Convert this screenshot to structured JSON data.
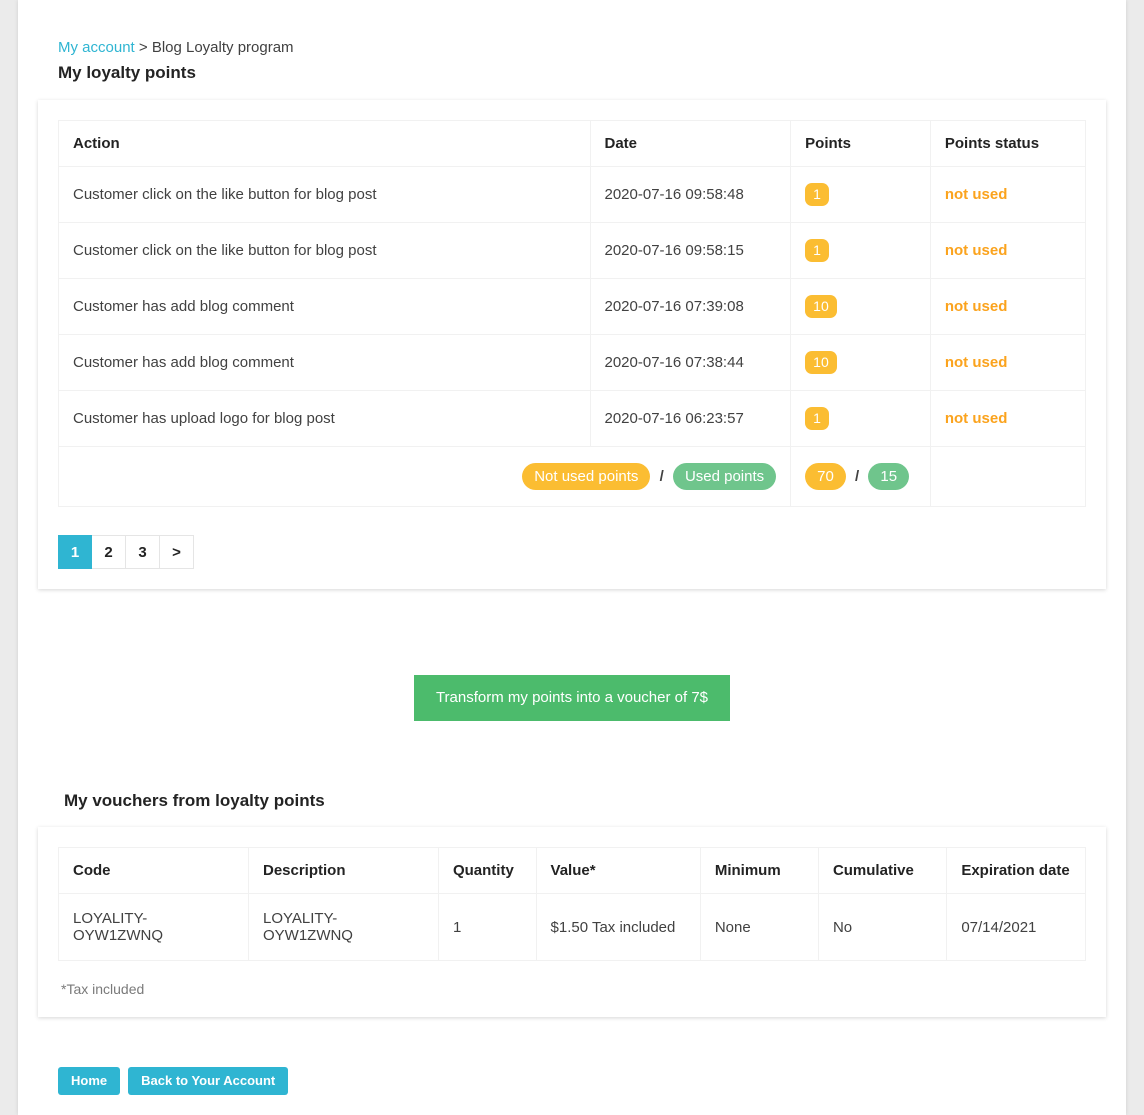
{
  "breadcrumb": {
    "link_label": "My account",
    "separator": ">",
    "current": "Blog Loyalty program"
  },
  "page_title": "My loyalty points",
  "colors": {
    "accent": "#2fb5d2",
    "orange_badge": "#fbbd32",
    "green_badge": "#6fc58c",
    "status_orange": "#fba31d",
    "green_button": "#4cbb6c",
    "page_background": "#ebebeb"
  },
  "points_table": {
    "headers": [
      "Action",
      "Date",
      "Points",
      "Points status"
    ],
    "rows": [
      {
        "action": "Customer click on the like button for blog post",
        "date": "2020-07-16 09:58:48",
        "points": "1",
        "status": "not used"
      },
      {
        "action": "Customer click on the like button for blog post",
        "date": "2020-07-16 09:58:15",
        "points": "1",
        "status": "not used"
      },
      {
        "action": "Customer has add blog comment",
        "date": "2020-07-16 07:39:08",
        "points": "10",
        "status": "not used"
      },
      {
        "action": "Customer has add blog comment",
        "date": "2020-07-16 07:38:44",
        "points": "10",
        "status": "not used"
      },
      {
        "action": "Customer has upload logo for blog post",
        "date": "2020-07-16 06:23:57",
        "points": "1",
        "status": "not used"
      }
    ],
    "summary": {
      "not_used_label": "Not used points",
      "separator": "/",
      "used_label": "Used points",
      "not_used_value": "70",
      "used_value": "15"
    }
  },
  "pagination": {
    "pages": [
      {
        "label": "1",
        "active": true
      },
      {
        "label": "2",
        "active": false
      },
      {
        "label": "3",
        "active": false
      },
      {
        "label": ">",
        "active": false
      }
    ]
  },
  "transform_button": {
    "label": "Transform my points into a voucher of 7$"
  },
  "vouchers_section": {
    "heading": "My vouchers from loyalty points",
    "headers": [
      "Code",
      "Description",
      "Quantity",
      "Value*",
      "Minimum",
      "Cumulative",
      "Expiration date"
    ],
    "rows": [
      {
        "code": "LOYALITY-OYW1ZWNQ",
        "description": "LOYALITY-OYW1ZWNQ",
        "quantity": "1",
        "value": "$1.50 Tax included",
        "minimum": "None",
        "cumulative": "No",
        "expiration": "07/14/2021"
      }
    ],
    "tax_note": "*Tax included"
  },
  "footer_actions": {
    "home_label": "Home",
    "account_label": "Back to Your Account"
  }
}
